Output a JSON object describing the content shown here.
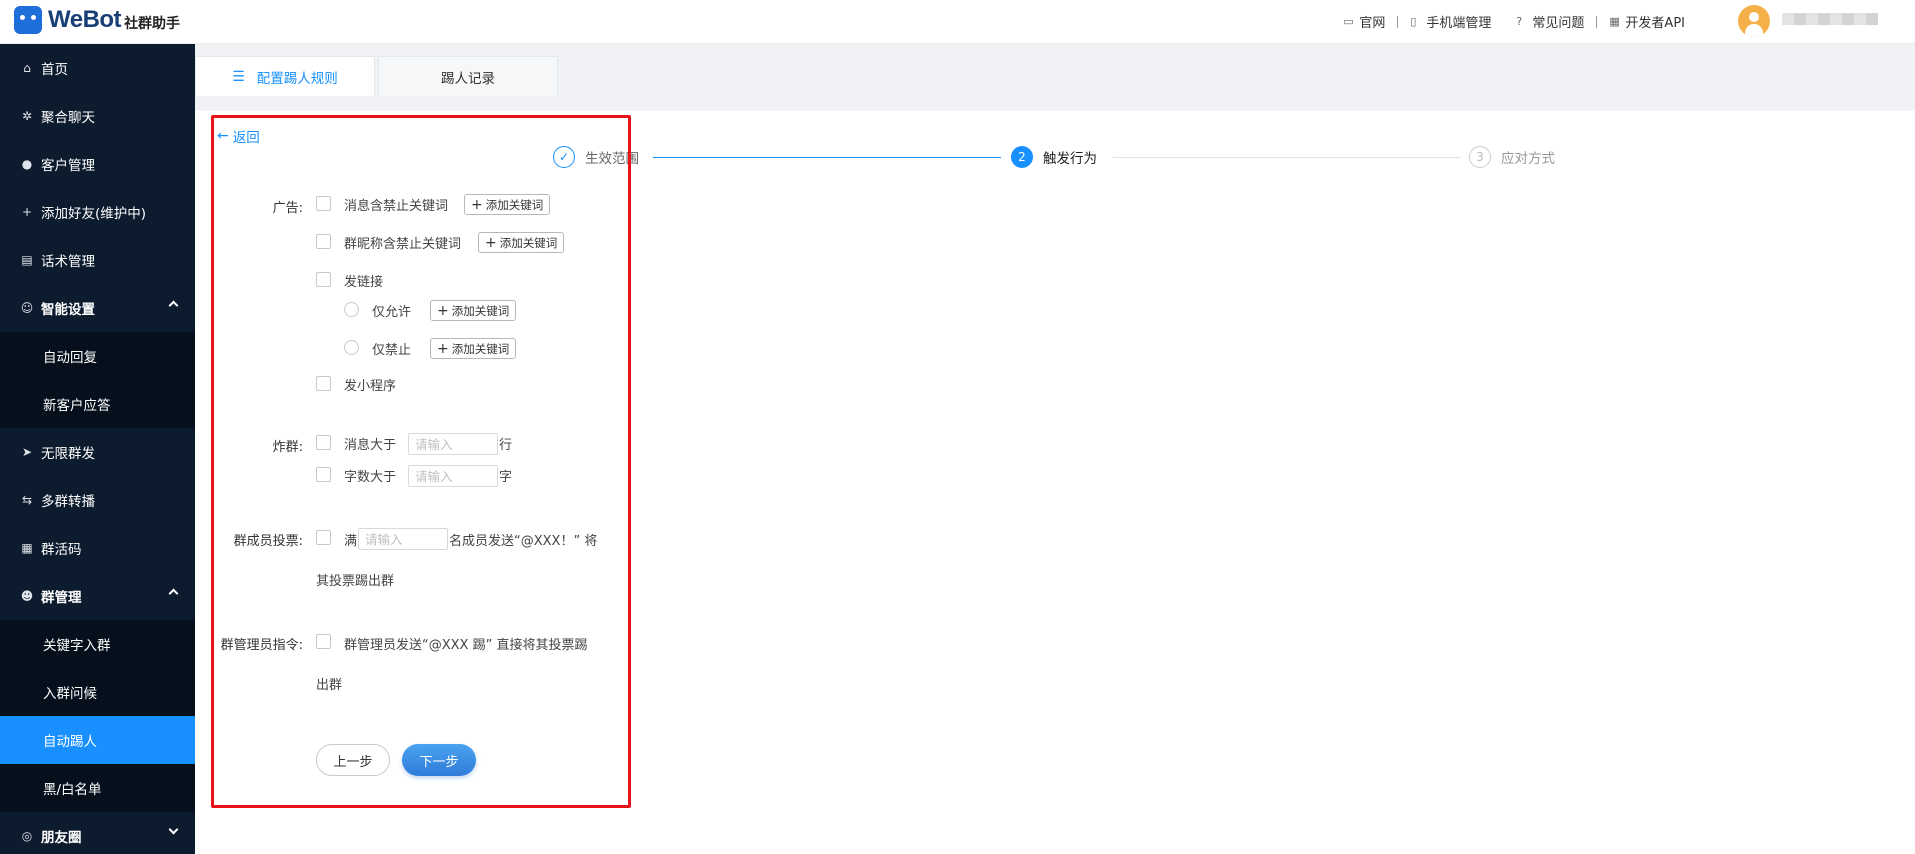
{
  "header": {
    "logo_text": "WeBot",
    "logo_sub": "社群助手",
    "nav": [
      {
        "icon": "monitor-icon",
        "label": "官网"
      },
      {
        "icon": "mobile-icon",
        "label": "手机端管理"
      },
      {
        "icon": "help-icon",
        "label": "常见问题"
      },
      {
        "icon": "api-icon",
        "label": "开发者API"
      }
    ]
  },
  "sidebar": {
    "items": [
      {
        "icon": "home-icon",
        "label": "首页"
      },
      {
        "icon": "chat-icon",
        "label": "聚合聊天"
      },
      {
        "icon": "user-icon",
        "label": "客户管理"
      },
      {
        "icon": "add-user-icon",
        "label": "添加好友(维护中)"
      },
      {
        "icon": "script-icon",
        "label": "话术管理"
      },
      {
        "icon": "smart-icon",
        "label": "智能设置"
      },
      {
        "label": "自动回复"
      },
      {
        "label": "新客户应答"
      },
      {
        "icon": "send-icon",
        "label": "无限群发"
      },
      {
        "icon": "forward-icon",
        "label": "多群转播"
      },
      {
        "icon": "qrcode-icon",
        "label": "群活码"
      },
      {
        "icon": "group-icon",
        "label": "群管理"
      },
      {
        "label": "关键字入群"
      },
      {
        "label": "入群问候"
      },
      {
        "label": "自动踢人"
      },
      {
        "label": "黑/白名单"
      },
      {
        "icon": "moments-icon",
        "label": "朋友圈"
      }
    ]
  },
  "tabs": [
    {
      "label": "配置踢人规则"
    },
    {
      "label": "踢人记录"
    }
  ],
  "back_label": "返回",
  "steps": [
    {
      "num": "✓",
      "label": "生效范围"
    },
    {
      "num": "2",
      "label": "触发行为"
    },
    {
      "num": "3",
      "label": "应对方式"
    }
  ],
  "form": {
    "ad": {
      "label": "广告:",
      "msg_keyword": "消息含禁止关键词",
      "nick_keyword": "群昵称含禁止关键词",
      "link": "发链接",
      "allow_only": "仅允许",
      "forbid_only": "仅禁止",
      "mini_program": "发小程序",
      "add_keyword": "添加关键词"
    },
    "flood": {
      "label": "炸群:",
      "msg_over": "消息大于",
      "msg_unit": "行",
      "char_over": "字数大于",
      "char_unit": "字",
      "placeholder": "请输入"
    },
    "vote": {
      "label": "群成员投票:",
      "prefix": "满",
      "placeholder": "请输入",
      "suffix": "名成员发送“@XXX！” 将",
      "line2": "其投票踢出群"
    },
    "admin": {
      "label": "群管理员指令:",
      "text": "群管理员发送“@XXX 踢” 直接将其投票踢",
      "line2": "出群"
    },
    "prev": "上一步",
    "next": "下一步"
  },
  "colors": {
    "accent": "#1890ff",
    "sidebar_bg": "#0c1b2e",
    "highlight": "#e8141c"
  }
}
